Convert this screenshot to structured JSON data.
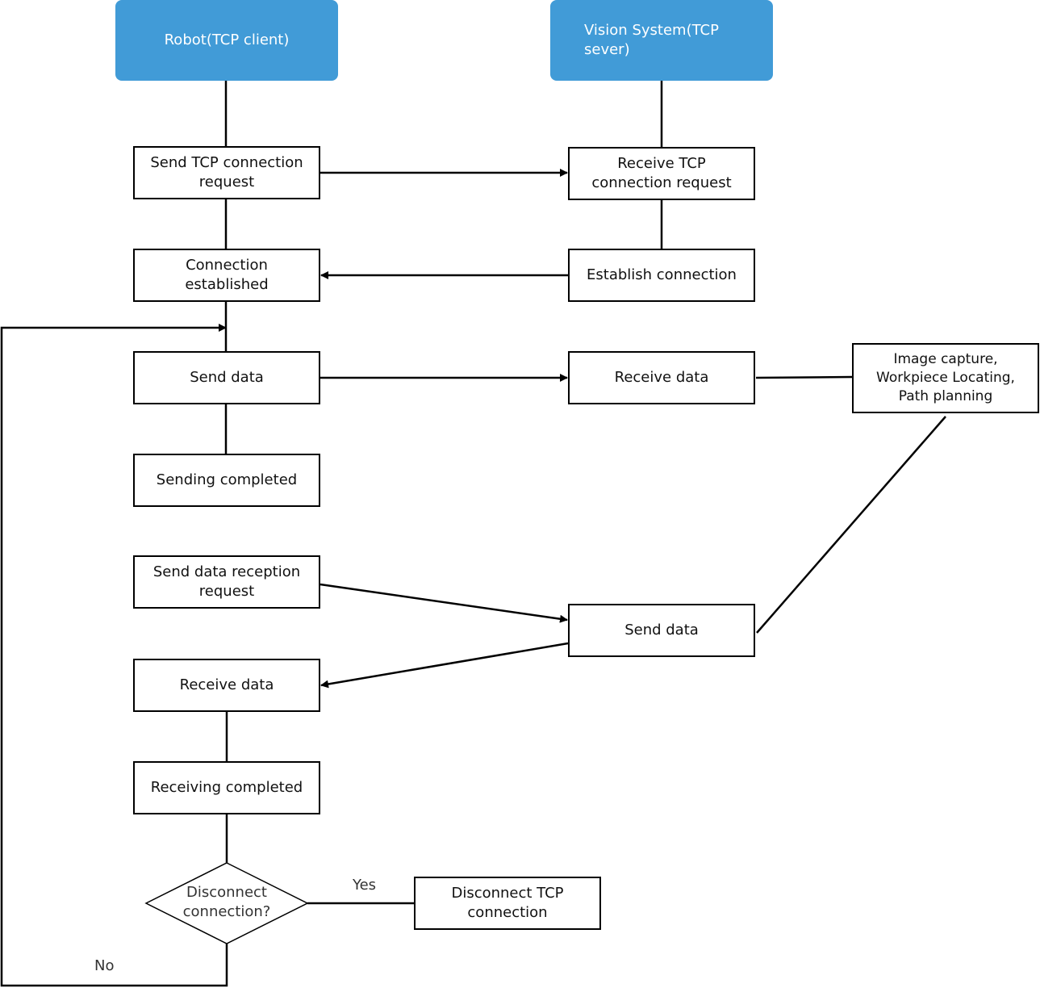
{
  "colors": {
    "header": "#419BD7",
    "line": "#000000"
  },
  "headers": {
    "robot": "Robot(TCP client)",
    "vision": "Vision System(TCP sever)"
  },
  "robot_steps": {
    "send_request": "Send TCP connection request",
    "connection_established": "Connection established",
    "send_data": "Send data",
    "sending_completed": "Sending completed",
    "send_reception_request": "Send data reception request",
    "receive_data": "Receive data",
    "receiving_completed": "Receiving completed"
  },
  "vision_steps": {
    "receive_request": "Receive TCP connection request",
    "establish": "Establish connection",
    "receive_data": "Receive data",
    "processing": "Image capture, Workpiece Locating, Path planning",
    "send_data": "Send data"
  },
  "decision": {
    "question": "Disconnect connection?",
    "yes": "Yes",
    "no": "No",
    "disconnect": "Disconnect TCP connection"
  }
}
